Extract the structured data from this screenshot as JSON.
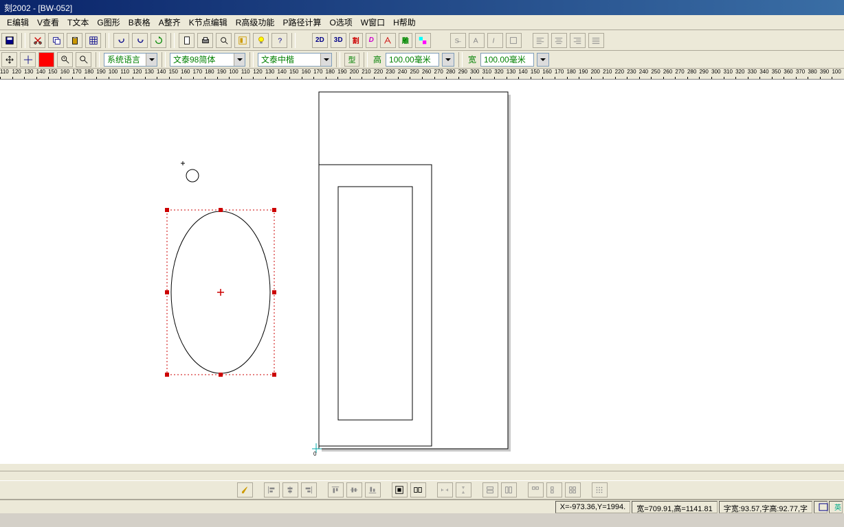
{
  "title": "刻2002 - [BW-052]",
  "menu": {
    "edit": "E编辑",
    "view": "V查看",
    "text": "T文本",
    "graphic": "G图形",
    "table": "B表格",
    "align": "A整齐",
    "node": "K节点编辑",
    "advanced": "R高级功能",
    "path": "P路径计算",
    "option": "O选项",
    "window": "W窗口",
    "help": "H帮助"
  },
  "toolbar": {
    "mode2d": "2D",
    "mode3d": "3D",
    "cut": "割",
    "dx": "D",
    "carve": "雕"
  },
  "fontbar": {
    "lang": "系统语言",
    "font1": "文泰98简体",
    "font2": "文泰中楷",
    "type": "型",
    "height_label": "高",
    "height": "100.00毫米",
    "width_label": "宽",
    "width": "100.00毫米"
  },
  "rulerMarks": [
    "110",
    "120",
    "130",
    "140",
    "150",
    "160",
    "170",
    "180",
    "190",
    "100",
    "110",
    "120",
    "130",
    "140",
    "150",
    "160",
    "170",
    "180",
    "190",
    "100",
    "110",
    "120",
    "130",
    "140",
    "150",
    "160",
    "170",
    "180",
    "190",
    "200",
    "210",
    "220",
    "230",
    "240",
    "250",
    "260",
    "270",
    "280",
    "290",
    "300",
    "310",
    "320",
    "130",
    "140",
    "150",
    "160",
    "170",
    "180",
    "190",
    "200",
    "210",
    "220",
    "230",
    "240",
    "250",
    "260",
    "270",
    "280",
    "290",
    "300",
    "310",
    "320",
    "330",
    "340",
    "350",
    "360",
    "370",
    "380",
    "390",
    "100"
  ],
  "status": {
    "coords": "X=-973.36,Y=1994.",
    "size": "宽=709.91,高=1141.81",
    "charsize": "字宽:93.57,字高:92.77,字"
  }
}
